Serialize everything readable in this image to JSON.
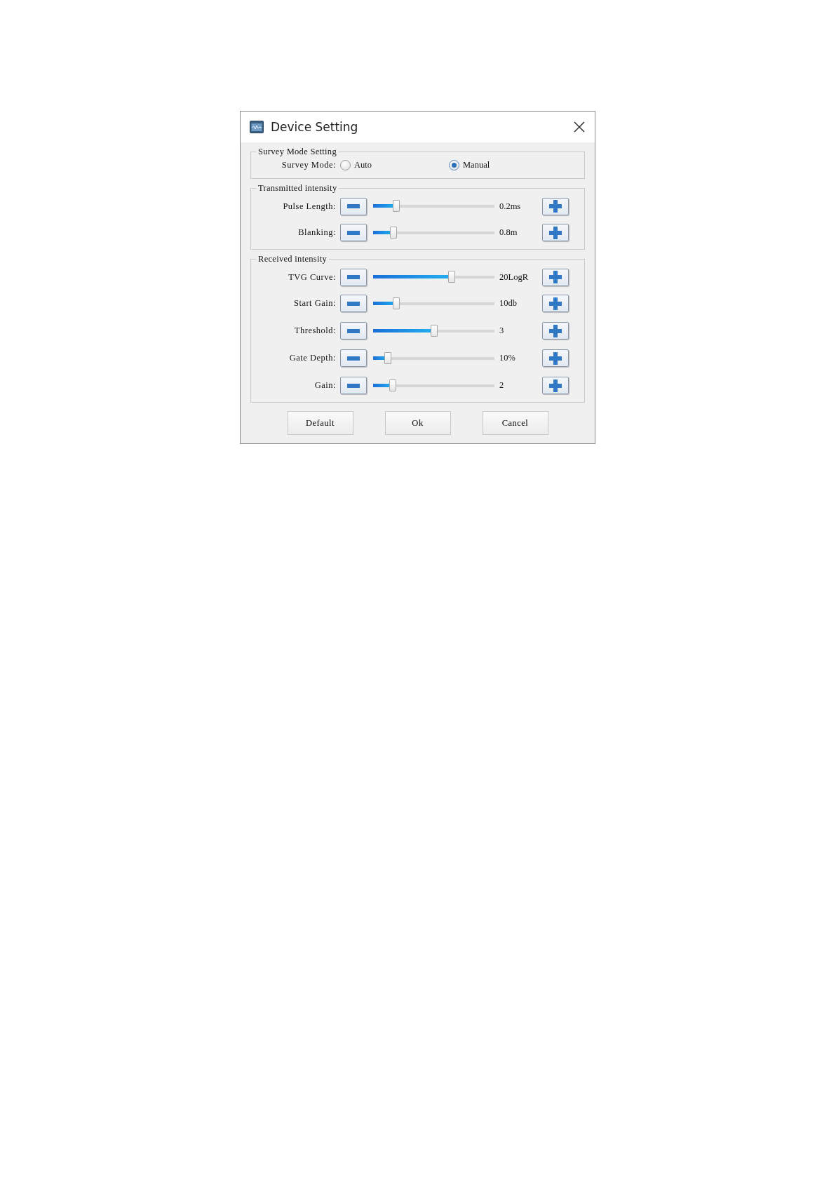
{
  "window": {
    "title": "Device Setting"
  },
  "survey_group": {
    "legend": "Survey Mode Setting",
    "label": "Survey Mode:",
    "options": [
      {
        "label": "Auto",
        "selected": false
      },
      {
        "label": "Manual",
        "selected": true
      }
    ]
  },
  "slider_groups": [
    {
      "legend": "Transmitted intensity",
      "rows": [
        {
          "label": "Pulse Length:",
          "level": 0.19,
          "reading": "0.2ms"
        },
        {
          "label": "Blanking:",
          "level": 0.17,
          "reading": "0.8m"
        }
      ]
    },
    {
      "legend": "Received intensity",
      "rows": [
        {
          "label": "TVG Curve:",
          "level": 0.65,
          "reading": "20LogR"
        },
        {
          "label": "Start Gain:",
          "level": 0.19,
          "reading": "10db"
        },
        {
          "label": "Threshold:",
          "level": 0.5,
          "reading": "3"
        },
        {
          "label": "Gate Depth:",
          "level": 0.12,
          "reading": "10%"
        },
        {
          "label": "Gain:",
          "level": 0.16,
          "reading": "2"
        }
      ]
    }
  ],
  "buttons": [
    "Default",
    "Ok",
    "Cancel"
  ]
}
